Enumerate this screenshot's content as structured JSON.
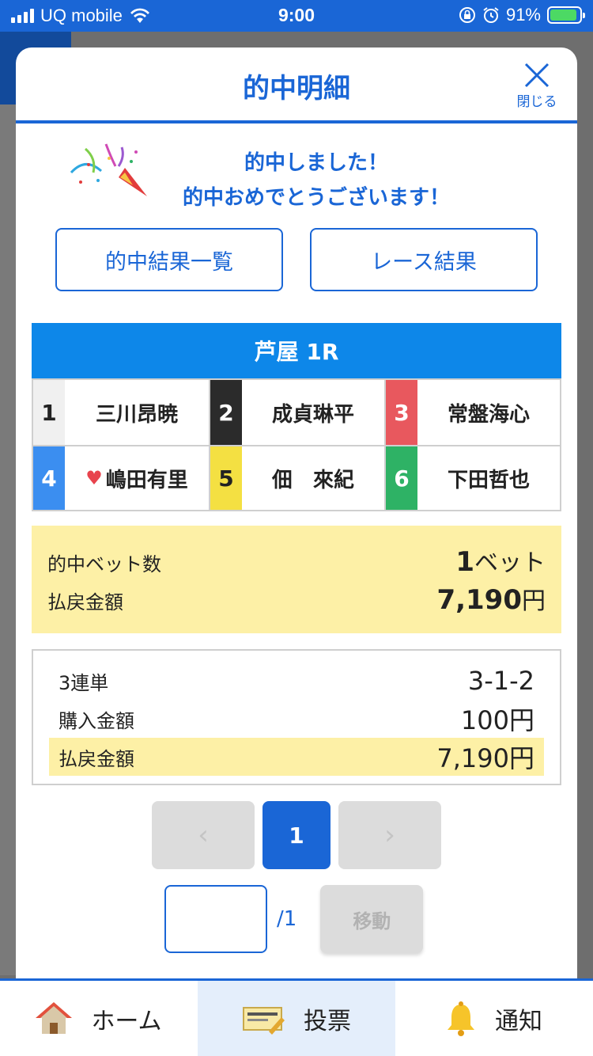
{
  "status_bar": {
    "carrier": "UQ mobile",
    "time": "9:00",
    "battery": "91%"
  },
  "modal": {
    "title": "的中明細",
    "close_label": "閉じる",
    "congrats_line1": "的中しました！",
    "congrats_line2": "的中おめでとうございます！",
    "buttons": {
      "hit_list": "的中結果一覧",
      "race_result": "レース結果"
    },
    "race_title": "芦屋 1R",
    "racers": [
      {
        "num": "1",
        "name": "三川昂暁",
        "color": "#f0f0f0",
        "text_color": "#222222"
      },
      {
        "num": "2",
        "name": "成貞琳平",
        "color": "#2b2b2b",
        "text_color": "#ffffff"
      },
      {
        "num": "3",
        "name": "常盤海心",
        "color": "#e8585e",
        "text_color": "#ffffff"
      },
      {
        "num": "4",
        "name": "嶋田有里",
        "color": "#3b8ef0",
        "text_color": "#ffffff",
        "favorite": true
      },
      {
        "num": "5",
        "name": "佃　來紀",
        "color": "#f4e042",
        "text_color": "#222222"
      },
      {
        "num": "6",
        "name": "下田哲也",
        "color": "#2eb265",
        "text_color": "#ffffff"
      }
    ],
    "summary": {
      "bets_label": "的中ベット数",
      "bets_value": "1",
      "bets_unit": "ベット",
      "payout_label": "払戻金額",
      "payout_value": "7,190",
      "payout_unit": "円"
    },
    "bet": {
      "type": "3連単",
      "combination": "3-1-2",
      "purchase_label": "購入金額",
      "purchase_value": "100円",
      "payout_label": "払戻金額",
      "payout_value": "7,190円"
    },
    "pager": {
      "current": "1",
      "total": "/1",
      "move_label": "移動",
      "prev": "‹",
      "next": "›"
    }
  },
  "tabbar": {
    "items": [
      {
        "label": "ホーム",
        "icon": "house-icon"
      },
      {
        "label": "投票",
        "icon": "ticket-icon"
      },
      {
        "label": "通知",
        "icon": "bell-icon"
      }
    ],
    "active": "投票"
  },
  "colors": {
    "accent": "#1a66d6",
    "race_header": "#0d87e9",
    "highlight": "#fdf0a6"
  }
}
